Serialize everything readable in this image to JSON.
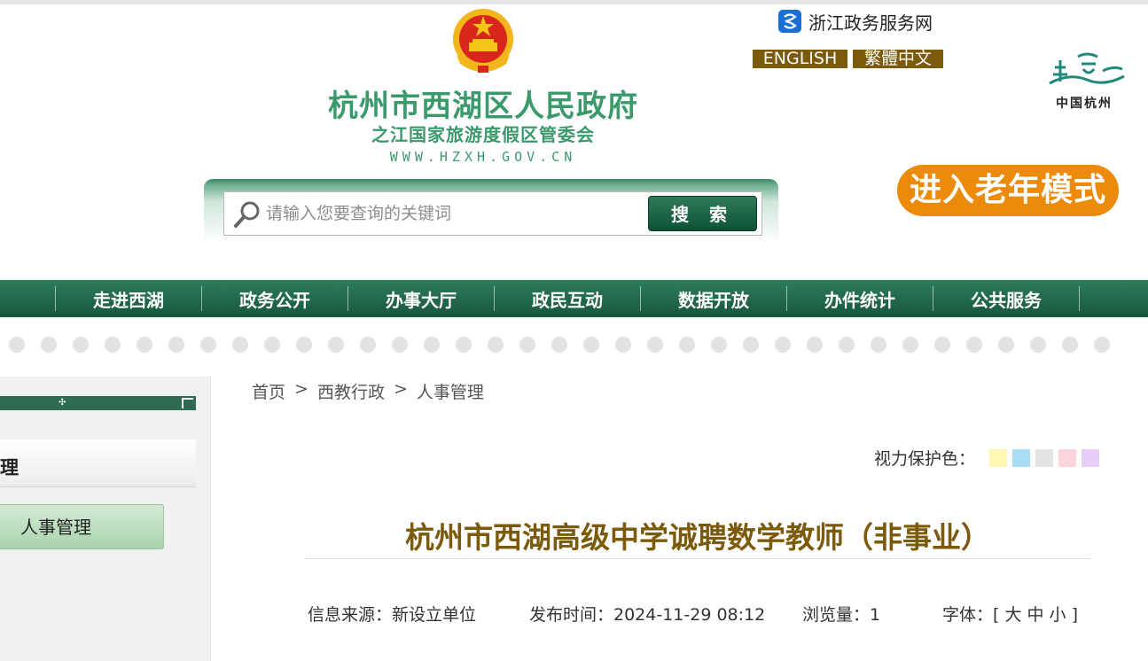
{
  "header": {
    "title": "杭州市西湖区人民政府",
    "subtitle": "之江国家旅游度假区管委会",
    "url": "WWW.HZXH.GOV.CN",
    "zj_link": "浙江政务服务网",
    "lang_en": "ENGLISH",
    "lang_tw": "繁體中文",
    "city_logo_text": "中国杭州",
    "elder_mode": "进入老年模式",
    "colors": {
      "green": "#3b9a6b",
      "brown": "#7c5a0b",
      "orange": "#ec8a0c"
    }
  },
  "search": {
    "placeholder": "请输入您要查询的关键词",
    "button": "搜 索"
  },
  "nav": {
    "items": [
      "走进西湖",
      "政务公开",
      "办事大厅",
      "政民互动",
      "数据开放",
      "办件统计",
      "公共服务"
    ]
  },
  "sidebar": {
    "title": "理",
    "item": "人事管理"
  },
  "breadcrumb": {
    "home": "首页",
    "level1": "西教行政",
    "level2": "人事管理",
    "sep": ">"
  },
  "eyecare": {
    "label": "视力保护色：",
    "colors": [
      "#fff7b3",
      "#a9dcf5",
      "#e3e3e3",
      "#fbd4de",
      "#e7cdf7"
    ]
  },
  "article": {
    "title": "杭州市西湖高级中学诚聘数学教师（非事业）",
    "source": "信息来源：新设立单位",
    "time": "发布时间：2024-11-29 08:12",
    "views": "浏览量：1",
    "font": "字体：[ 大 中 小 ]"
  }
}
